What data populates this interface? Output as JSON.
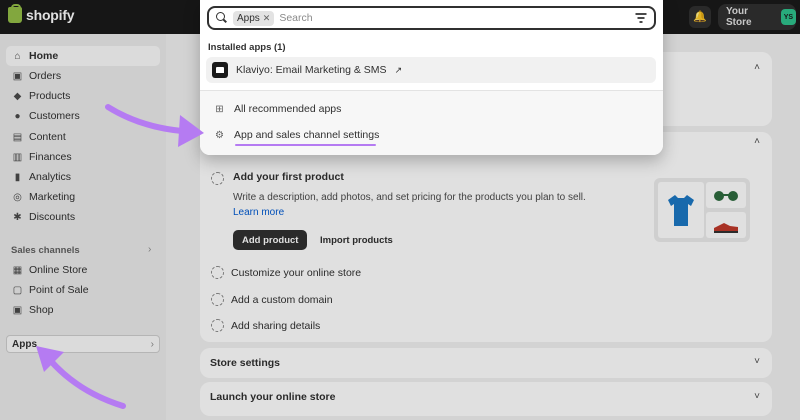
{
  "topbar": {
    "logo_text": "shopify",
    "store_label": "Your Store",
    "avatar_initials": "YS"
  },
  "sidebar": {
    "items": [
      {
        "label": "Home",
        "icon": "home-icon"
      },
      {
        "label": "Orders",
        "icon": "orders-icon"
      },
      {
        "label": "Products",
        "icon": "tag-icon"
      },
      {
        "label": "Customers",
        "icon": "person-icon"
      },
      {
        "label": "Content",
        "icon": "content-icon"
      },
      {
        "label": "Finances",
        "icon": "bank-icon"
      },
      {
        "label": "Analytics",
        "icon": "chart-icon"
      },
      {
        "label": "Marketing",
        "icon": "target-icon"
      },
      {
        "label": "Discounts",
        "icon": "discount-icon"
      }
    ],
    "sales_channels_label": "Sales channels",
    "channels": [
      {
        "label": "Online Store",
        "icon": "store-icon"
      },
      {
        "label": "Point of Sale",
        "icon": "pos-icon"
      },
      {
        "label": "Shop",
        "icon": "shop-icon"
      }
    ],
    "apps_label": "Apps"
  },
  "main": {
    "setup": {
      "step_title": "Add your first product",
      "step_desc": "Write a description, add photos, and set pricing for the products you plan to sell.",
      "learn_more": "Learn more",
      "primary_button": "Add product",
      "secondary_button": "Import products",
      "other_steps": [
        "Customize your online store",
        "Add a custom domain",
        "Add sharing details"
      ]
    },
    "store_settings": "Store settings",
    "launch": "Launch your online store"
  },
  "search": {
    "chip_label": "Apps",
    "placeholder": "Search",
    "installed_label": "Installed apps (1)",
    "result_label": "Klaviyo: Email Marketing & SMS",
    "links": [
      "All recommended apps",
      "App and sales channel settings"
    ]
  },
  "colors": {
    "annotation": "#b57bf2",
    "topbar": "#1a1a1a",
    "avatar": "#2ec28d"
  }
}
